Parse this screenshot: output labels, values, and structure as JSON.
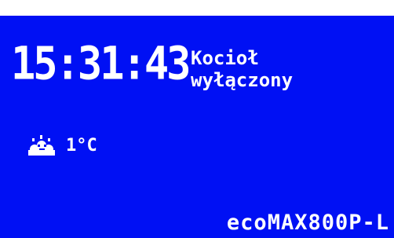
{
  "display": {
    "time": "15:31:43",
    "status_line1": "Kocioł",
    "status_line2": "wyłączony",
    "weather_icon": "cloud-sun-icon",
    "outdoor_temp": "1°C",
    "model": "ecoMAX800P-L",
    "background_color": "#0010f4",
    "text_color": "#ffffff"
  }
}
